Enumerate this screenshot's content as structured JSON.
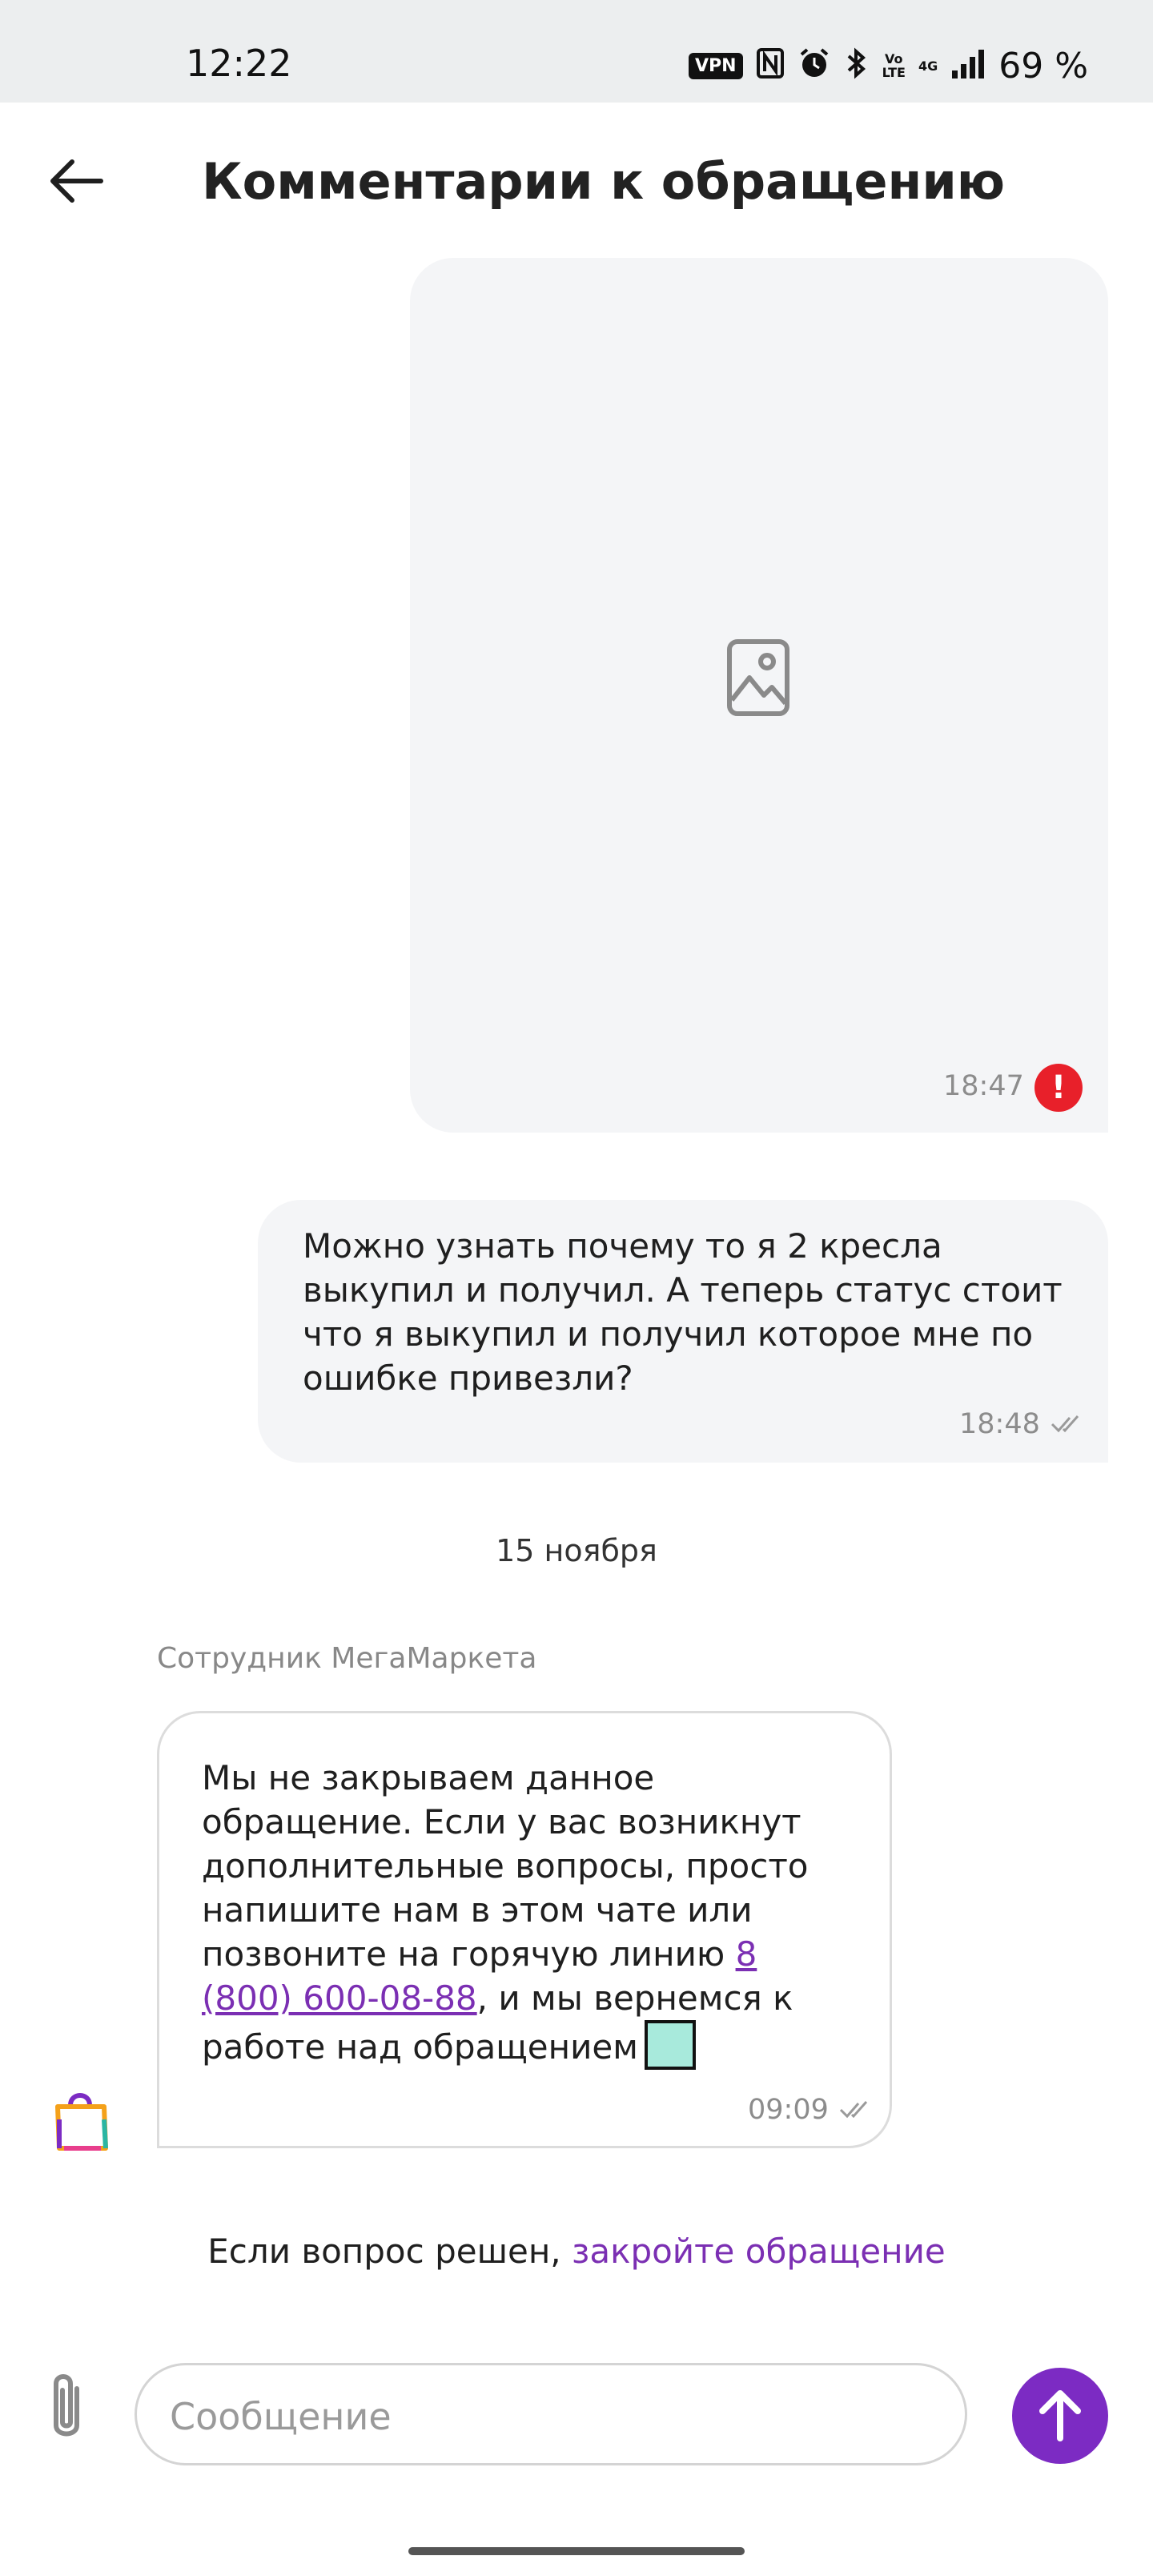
{
  "status_bar": {
    "time": "12:22",
    "vpn": "VPN",
    "volte_top": "Vo",
    "volte_bottom": "LTE",
    "network": "4G",
    "battery": "69 %"
  },
  "header": {
    "title": "Комментарии к обращению"
  },
  "messages": [
    {
      "type": "image",
      "time": "18:47",
      "status_icon": "error-icon",
      "status_symbol": "!"
    },
    {
      "type": "text",
      "text": "Можно узнать почему то я 2 кресла выкупил и получил. А теперь статус стоит что я выкупил и получил которое мне по ошибке привезли?",
      "time": "18:48"
    }
  ],
  "date_separator": "15 ноября",
  "incoming": {
    "sender": "Сотрудник МегаМаркета",
    "text_before": "Мы не закрываем данное обращение. Если у вас возникнут дополнительные вопросы, просто напишите нам в этом чате или позвоните на горячую линию ",
    "phone": "8 (800) 600-08-88",
    "text_after": ", и мы вернемся к работе над обращением",
    "time": "09:09"
  },
  "close_prompt": {
    "text": "Если вопрос решен, ",
    "link": "закройте обращение"
  },
  "composer": {
    "placeholder": "Сообщение"
  },
  "colors": {
    "accent": "#7c2bc3",
    "error": "#e8202a",
    "bubble_bg": "#f4f5f7"
  }
}
